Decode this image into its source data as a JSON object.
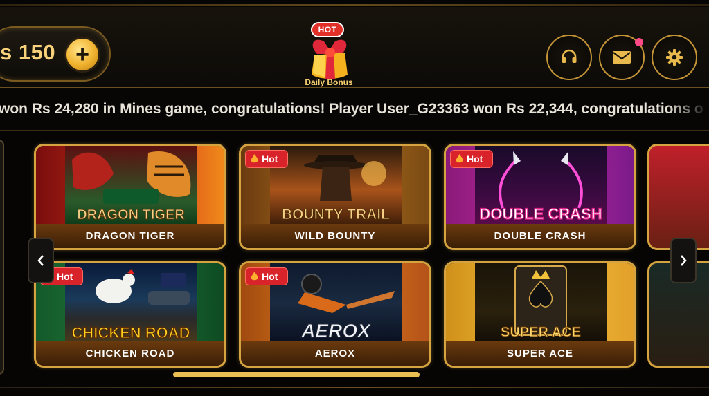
{
  "header": {
    "balance_text": "s 150",
    "add_label": "+",
    "bonus": {
      "hot_label": "HOT",
      "label": "Daily Bonus"
    },
    "buttons": [
      {
        "name": "support-button",
        "icon": "headset-icon"
      },
      {
        "name": "mail-button",
        "icon": "mail-icon",
        "has_notification": true
      },
      {
        "name": "settings-button",
        "icon": "gear-icon"
      }
    ]
  },
  "marquee": {
    "text": "won Rs 24,280 in Mines game, congratulations! Player User_G23363 won Rs 22,344, congratulations o"
  },
  "games": {
    "hot_badge": "Hot",
    "cards": [
      {
        "title": "DRAGON TIGER",
        "poster": "DRAGON TIGER",
        "hot": false,
        "theme": "red"
      },
      {
        "title": "WILD BOUNTY",
        "poster": "BOUNTY TRAIL",
        "hot": true,
        "theme": "brown"
      },
      {
        "title": "DOUBLE CRASH",
        "poster": "DOUBLE CRASH",
        "hot": true,
        "theme": "purple"
      },
      {
        "title": "CHICKEN ROAD",
        "poster": "CHICKEN ROAD",
        "hot": true,
        "theme": "green"
      },
      {
        "title": "AEROX",
        "poster": "AEROX",
        "hot": true,
        "theme": "orange"
      },
      {
        "title": "SUPER ACE",
        "poster": "SUPER ACE",
        "hot": false,
        "theme": "gold"
      }
    ]
  },
  "colors": {
    "accent_gold": "#d5a33f",
    "balance_text": "#f8d27a",
    "hot_red": "#d8232a",
    "notification": "#ff4a88"
  }
}
